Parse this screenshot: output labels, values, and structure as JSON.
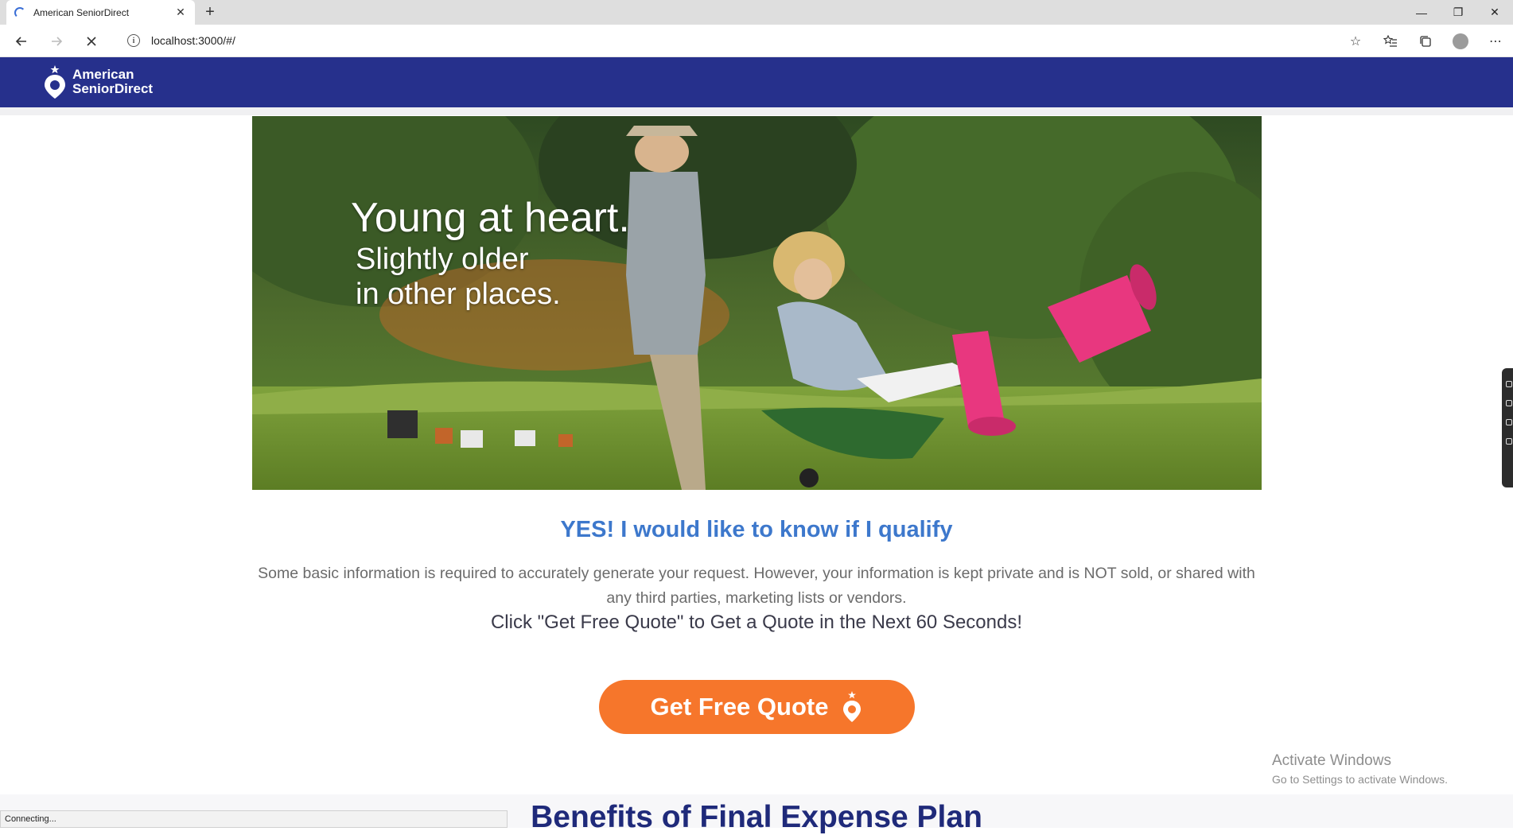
{
  "browser": {
    "tab_title": "American SeniorDirect",
    "tab_close": "✕",
    "new_tab": "+",
    "url": "localhost:3000/#/",
    "status": "Connecting...",
    "win_min": "—",
    "win_restore": "❐",
    "win_close": "✕"
  },
  "header": {
    "logo_line1": "American",
    "logo_line2": "SeniorDirect",
    "brand_color": "#26308c"
  },
  "hero": {
    "line1": "Young at heart.",
    "line2": "Slightly older",
    "line3": "in other places."
  },
  "main": {
    "qualify_heading": "YES! I would like to know if I qualify",
    "description": "Some basic information is required to accurately generate your request. However, your information is kept private and is NOT sold, or shared with any third parties, marketing lists or vendors.",
    "click_text": "Click \"Get Free Quote\" to Get a Quote in the Next 60 Seconds!",
    "cta_label": "Get Free Quote",
    "cta_color": "#f6762b",
    "heading_color": "#3d78cc"
  },
  "benefits": {
    "title": "Benefits of Final Expense Plan"
  },
  "watermark": {
    "line1": "Activate Windows",
    "line2": "Go to Settings to activate Windows."
  }
}
